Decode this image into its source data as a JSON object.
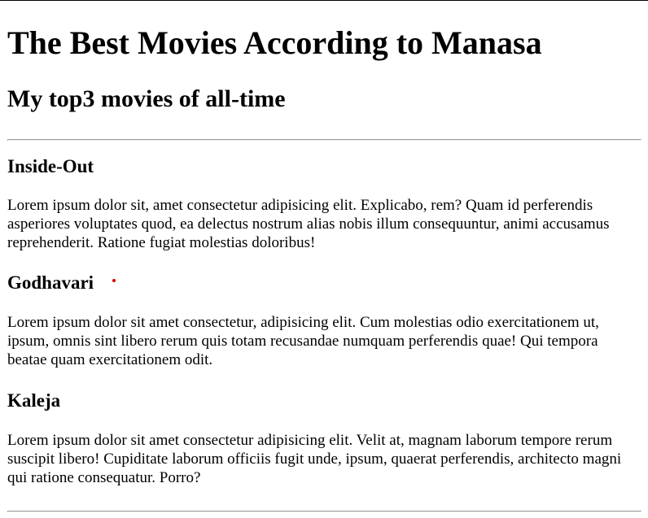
{
  "page": {
    "title": "The Best Movies According to Manasa",
    "subtitle": "My top3 movies of all-time"
  },
  "movies": [
    {
      "title": "Inside-Out",
      "description": "Lorem ipsum dolor sit, amet consectetur adipisicing elit. Explicabo, rem? Quam id perferendis asperiores voluptates quod, ea delectus nostrum alias nobis illum consequuntur, animi accusamus reprehenderit. Ratione fugiat molestias doloribus!"
    },
    {
      "title": "Godhavari",
      "description": "Lorem ipsum dolor sit amet consectetur, adipisicing elit. Cum molestias odio exercitationem ut, ipsum, omnis sint libero rerum quis totam recusandae numquam perferendis quae! Qui tempora beatae quam exercitationem odit."
    },
    {
      "title": "Kaleja",
      "description": "Lorem ipsum dolor sit amet consectetur adipisicing elit. Velit at, magnam laborum tempore rerum suscipit libero! Cupiditate laborum officiis fugit unde, ipsum, quaerat perferendis, architecto magni qui ratione consequatur. Porro?"
    }
  ],
  "colors": {
    "text": "#000000",
    "rule": "#9a9a9a",
    "cursor_dot": "#d40000"
  }
}
